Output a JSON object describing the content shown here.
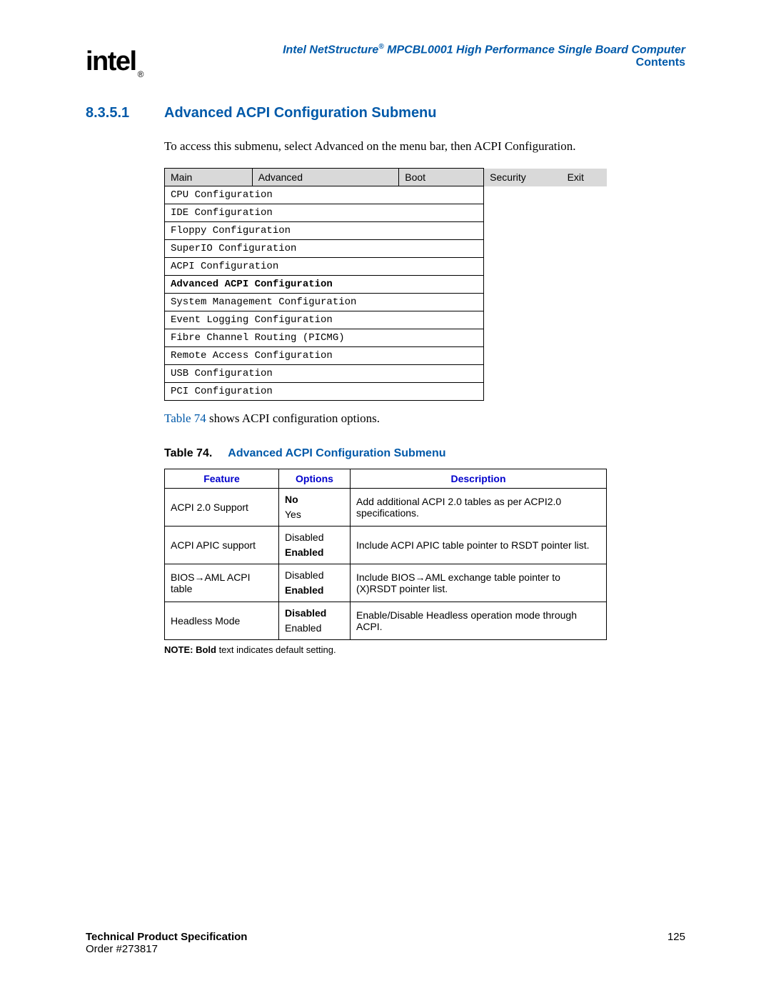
{
  "header": {
    "logo_text": "intel",
    "logo_reg": "®",
    "doc_title_prefix": "Intel NetStructure",
    "doc_title_reg": "®",
    "doc_title_suffix": " MPCBL0001 High Performance Single Board Computer",
    "contents": "Contents"
  },
  "section": {
    "number": "8.3.5.1",
    "title": "Advanced ACPI Configuration Submenu",
    "intro": "To access this submenu, select Advanced on the menu bar, then ACPI Configuration."
  },
  "bios_menu": {
    "tabs": [
      "Main",
      "Advanced",
      "Boot",
      "Security",
      "Exit"
    ],
    "items": [
      "CPU Configuration",
      "IDE Configuration",
      "Floppy Configuration",
      "SuperIO Configuration",
      "ACPI Configuration",
      "Advanced ACPI Configuration",
      "System Management Configuration",
      "Event Logging Configuration",
      "Fibre Channel Routing (PICMG)",
      "Remote Access Configuration",
      "USB Configuration",
      "PCI Configuration"
    ],
    "bold_index": 5
  },
  "caption": {
    "link": "Table 74",
    "rest": " shows ACPI configuration options."
  },
  "table74": {
    "label": "Table 74.",
    "title": "Advanced ACPI Configuration Submenu",
    "headers": [
      "Feature",
      "Options",
      "Description"
    ],
    "rows": [
      {
        "feature": "ACPI 2.0 Support",
        "options": [
          {
            "text": "No",
            "bold": true
          },
          {
            "text": "Yes",
            "bold": false
          }
        ],
        "desc": "Add additional ACPI 2.0 tables as per ACPI2.0 specifications."
      },
      {
        "feature": "ACPI APIC support",
        "options": [
          {
            "text": "Disabled",
            "bold": false
          },
          {
            "text": "Enabled",
            "bold": true
          }
        ],
        "desc": "Include ACPI APIC table pointer to RSDT pointer list."
      },
      {
        "feature": "BIOS→AML ACPI table",
        "options": [
          {
            "text": "Disabled",
            "bold": false
          },
          {
            "text": "Enabled",
            "bold": true
          }
        ],
        "desc": "Include BIOS→AML exchange table pointer to (X)RSDT pointer list."
      },
      {
        "feature": "Headless Mode",
        "options": [
          {
            "text": "Disabled",
            "bold": true
          },
          {
            "text": "Enabled",
            "bold": false
          }
        ],
        "desc": "Enable/Disable Headless operation mode through ACPI."
      }
    ],
    "note_prefix": "NOTE:  ",
    "note_bold": "Bold",
    "note_rest": " text indicates default setting."
  },
  "footer": {
    "line1": "Technical Product Specification",
    "line2": "Order #273817",
    "page": "125"
  }
}
